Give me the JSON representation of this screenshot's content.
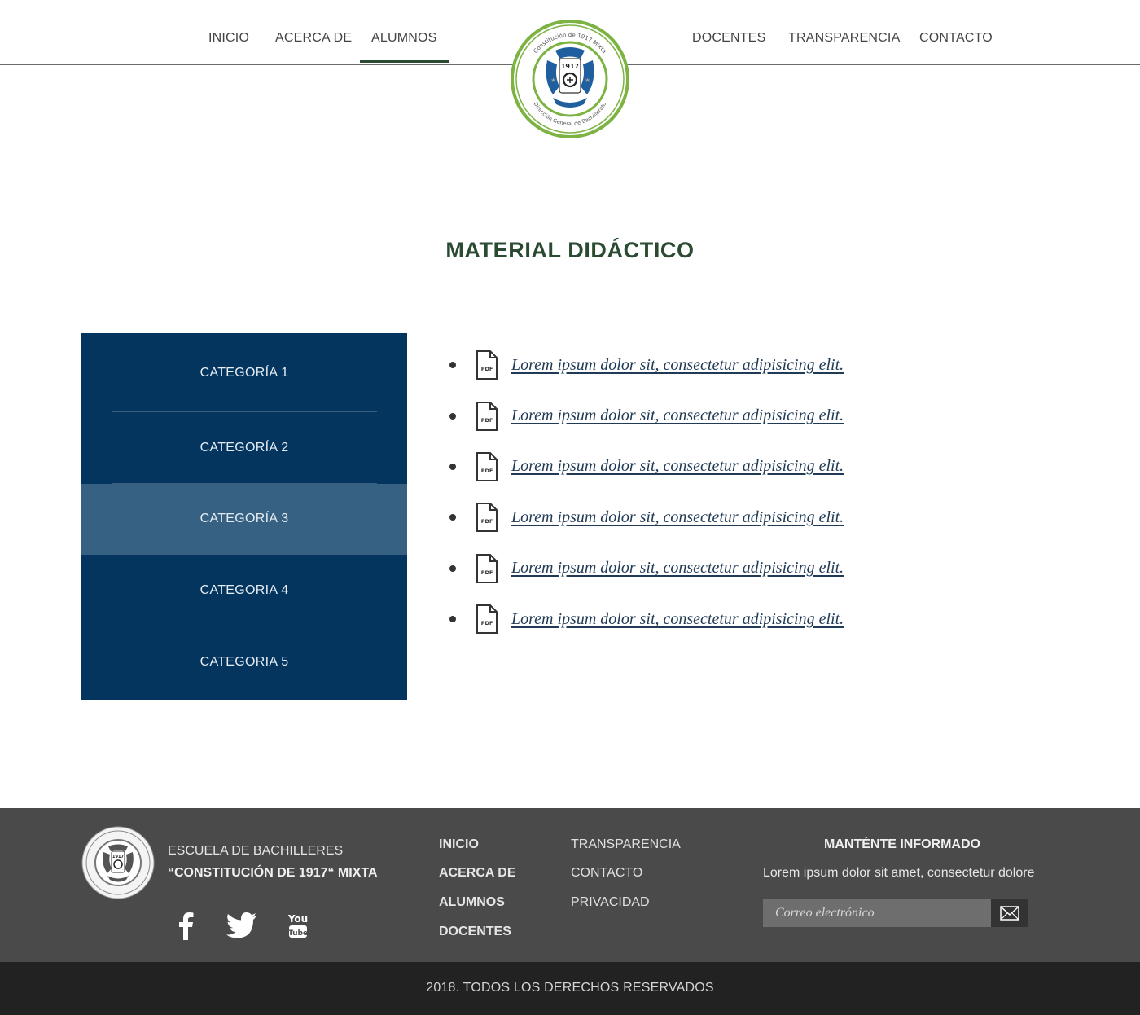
{
  "nav": {
    "left": [
      "INICIO",
      "ACERCA DE",
      "ALUMNOS"
    ],
    "right": [
      "DOCENTES",
      "TRANSPARENCIA",
      "CONTACTO"
    ],
    "active": "ALUMNOS"
  },
  "logo": {
    "year": "1917",
    "ring_text_top": "Constitución de 1917 Mixta",
    "ring_text_bottom": "Dirección General de Bachillerato",
    "ring_color": "#7cb342",
    "emblem_color": "#1f5fa0"
  },
  "page": {
    "title": "MATERIAL DIDÁCTICO"
  },
  "categories": {
    "items": [
      "CATEGORÍA 1",
      "CATEGORÍA 2",
      "CATEGORÍA 3",
      "CATEGORIA 4",
      "CATEGORIA 5"
    ],
    "active_index": 2
  },
  "documents": {
    "icon": "pdf-file-icon",
    "icon_label": "PDF",
    "items": [
      "Lorem ipsum dolor sit, consectetur adipisicing elit.",
      "Lorem ipsum dolor sit, consectetur adipisicing elit.",
      "Lorem ipsum dolor sit, consectetur adipisicing elit.",
      "Lorem ipsum dolor sit, consectetur adipisicing elit.",
      "Lorem ipsum dolor sit, consectetur adipisicing elit.",
      "Lorem ipsum dolor sit, consectetur adipisicing elit."
    ]
  },
  "footer": {
    "school_line1": "ESCUELA DE BACHILLERES",
    "school_line2": "“CONSTITUCIÓN DE 1917“ MIXTA",
    "social": [
      "facebook-icon",
      "twitter-icon",
      "youtube-icon"
    ],
    "youtube_text_top": "You",
    "youtube_text_bottom": "Tube",
    "links_col1": [
      "INICIO",
      "ACERCA DE",
      "ALUMNOS",
      "DOCENTES"
    ],
    "links_col2": [
      "TRANSPARENCIA",
      "CONTACTO",
      "PRIVACIDAD"
    ],
    "newsletter_title": "MANTÉNTE INFORMADO",
    "newsletter_text": "Lorem ipsum dolor sit amet, consectetur dolore",
    "email_placeholder": "Correo electrónico",
    "copyright": "2018. TODOS LOS DERECHOS RESERVADOS"
  },
  "colors": {
    "primary_green": "#2b4a32",
    "category_bg": "#03355f",
    "category_active": "#366183",
    "footer_bg": "#4a4a4a",
    "bottombar_bg": "#222222"
  }
}
